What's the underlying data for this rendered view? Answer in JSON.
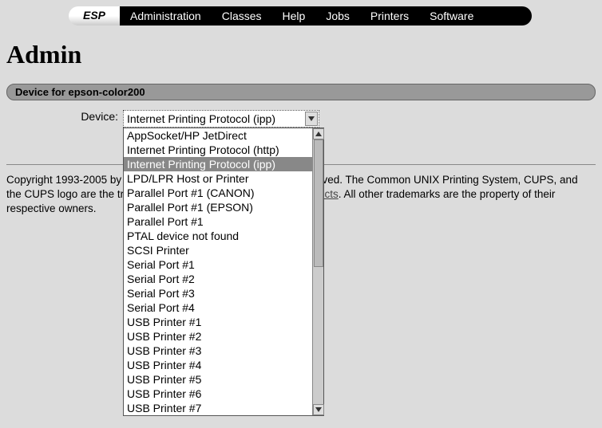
{
  "nav": {
    "brand": "ESP",
    "items": [
      "Administration",
      "Classes",
      "Help",
      "Jobs",
      "Printers",
      "Software"
    ]
  },
  "page_title": "Admin",
  "section_title": "Device for epson-color200",
  "form": {
    "device_label": "Device:",
    "device_selected": "Internet Printing Protocol (ipp)",
    "device_options": [
      "AppSocket/HP JetDirect",
      "Internet Printing Protocol (http)",
      "Internet Printing Protocol (ipp)",
      "LPD/LPR Host or Printer",
      "Parallel Port #1 (CANON)",
      "Parallel Port #1 (EPSON)",
      "Parallel Port #1",
      "PTAL device not found",
      "SCSI Printer",
      "Serial Port #1",
      "Serial Port #2",
      "Serial Port #3",
      "Serial Port #4",
      "USB Printer #1",
      "USB Printer #2",
      "USB Printer #3",
      "USB Printer #4",
      "USB Printer #5",
      "USB Printer #6",
      "USB Printer #7"
    ],
    "selected_index": 2
  },
  "footer": {
    "text_before": "Copyright 1993-2005 by Easy Software Products, All Rights Reserved. The Common UNIX Printing System, CUPS, and the CUPS logo are the trademark property of ",
    "link_text": "Easy Software Products",
    "text_after": ". All other trademarks are the property of their respective owners."
  }
}
